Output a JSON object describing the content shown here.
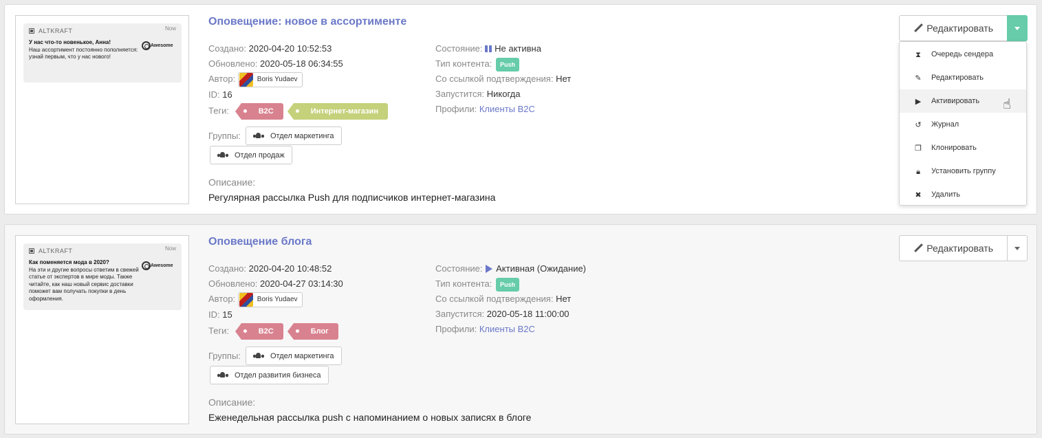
{
  "cards": [
    {
      "preview": {
        "app_name": "ALTKRAFT",
        "time": "Now",
        "title": "У нас что-то новенькое, Анна!",
        "body": "Наш ассортимент постоянно пополняется: узнай первым, что у нас нового!",
        "logo_text": "Awesome"
      },
      "title": "Оповещение: новое в ассортименте",
      "created_label": "Создано:",
      "created": "2020-04-20 10:52:53",
      "updated_label": "Обновлено:",
      "updated": "2020-05-18 06:34:55",
      "author_label": "Автор:",
      "author": "Boris Yudaev",
      "id_label": "ID:",
      "id": "16",
      "tags_label": "Теги:",
      "tags": [
        "B2C",
        "Интернет-магазин"
      ],
      "groups_label": "Группы:",
      "groups": [
        "Отдел маркетинга",
        "Отдел продаж"
      ],
      "state_label": "Состояние:",
      "state": "Не активна",
      "content_type_label": "Тип контента:",
      "content_type": "Push",
      "confirm_label": "Со ссылкой подтверждения:",
      "confirm": "Нет",
      "launch_label": "Запустится:",
      "launch": "Никогда",
      "profiles_label": "Профили:",
      "profiles": "Клиенты B2C",
      "desc_label": "Описание:",
      "desc": "Регулярная рассылка Push для подписчиков интернет-магазина",
      "edit_label": "Редактировать"
    },
    {
      "preview": {
        "app_name": "ALTKRAFT",
        "time": "Now",
        "title": "Как поменяется мода в 2020?",
        "body": "На эти и другие вопросы ответим в свежей статье от экспертов в мире моды. Также читайте, как наш новый сервис доставки поможет вам получать покупки в день оформления.",
        "logo_text": "Awesome"
      },
      "title": "Оповещение блога",
      "created_label": "Создано:",
      "created": "2020-04-20 10:48:52",
      "updated_label": "Обновлено:",
      "updated": "2020-04-27 03:14:30",
      "author_label": "Автор:",
      "author": "Boris Yudaev",
      "id_label": "ID:",
      "id": "15",
      "tags_label": "Теги:",
      "tags": [
        "B2C",
        "Блог"
      ],
      "groups_label": "Группы:",
      "groups": [
        "Отдел маркетинга",
        "Отдел развития бизнеса"
      ],
      "state_label": "Состояние:",
      "state": "Активная (Ожидание)",
      "content_type_label": "Тип контента:",
      "content_type": "Push",
      "confirm_label": "Со ссылкой подтверждения:",
      "confirm": "Нет",
      "launch_label": "Запустится:",
      "launch": "2020-05-18 11:00:00",
      "profiles_label": "Профили:",
      "profiles": "Клиенты B2C",
      "desc_label": "Описание:",
      "desc": "Еженедельная рассылка push с напоминанием о новых записях в блоге",
      "edit_label": "Редактировать"
    }
  ],
  "dropdown": {
    "items": [
      {
        "label": "Очередь сендера",
        "icon": "hourglass-icon"
      },
      {
        "label": "Редактировать",
        "icon": "pencil-icon"
      },
      {
        "label": "Активировать",
        "icon": "play-icon"
      },
      {
        "label": "Журнал",
        "icon": "history-icon"
      },
      {
        "label": "Клонировать",
        "icon": "copy-icon"
      },
      {
        "label": "Установить группу",
        "icon": "lock-icon"
      },
      {
        "label": "Удалить",
        "icon": "close-icon"
      }
    ]
  },
  "colors": {
    "accent": "#6a78c8",
    "push": "#66ccaa",
    "tag_b2c": "#d9828f",
    "tag_shop": "#c5d17b"
  }
}
